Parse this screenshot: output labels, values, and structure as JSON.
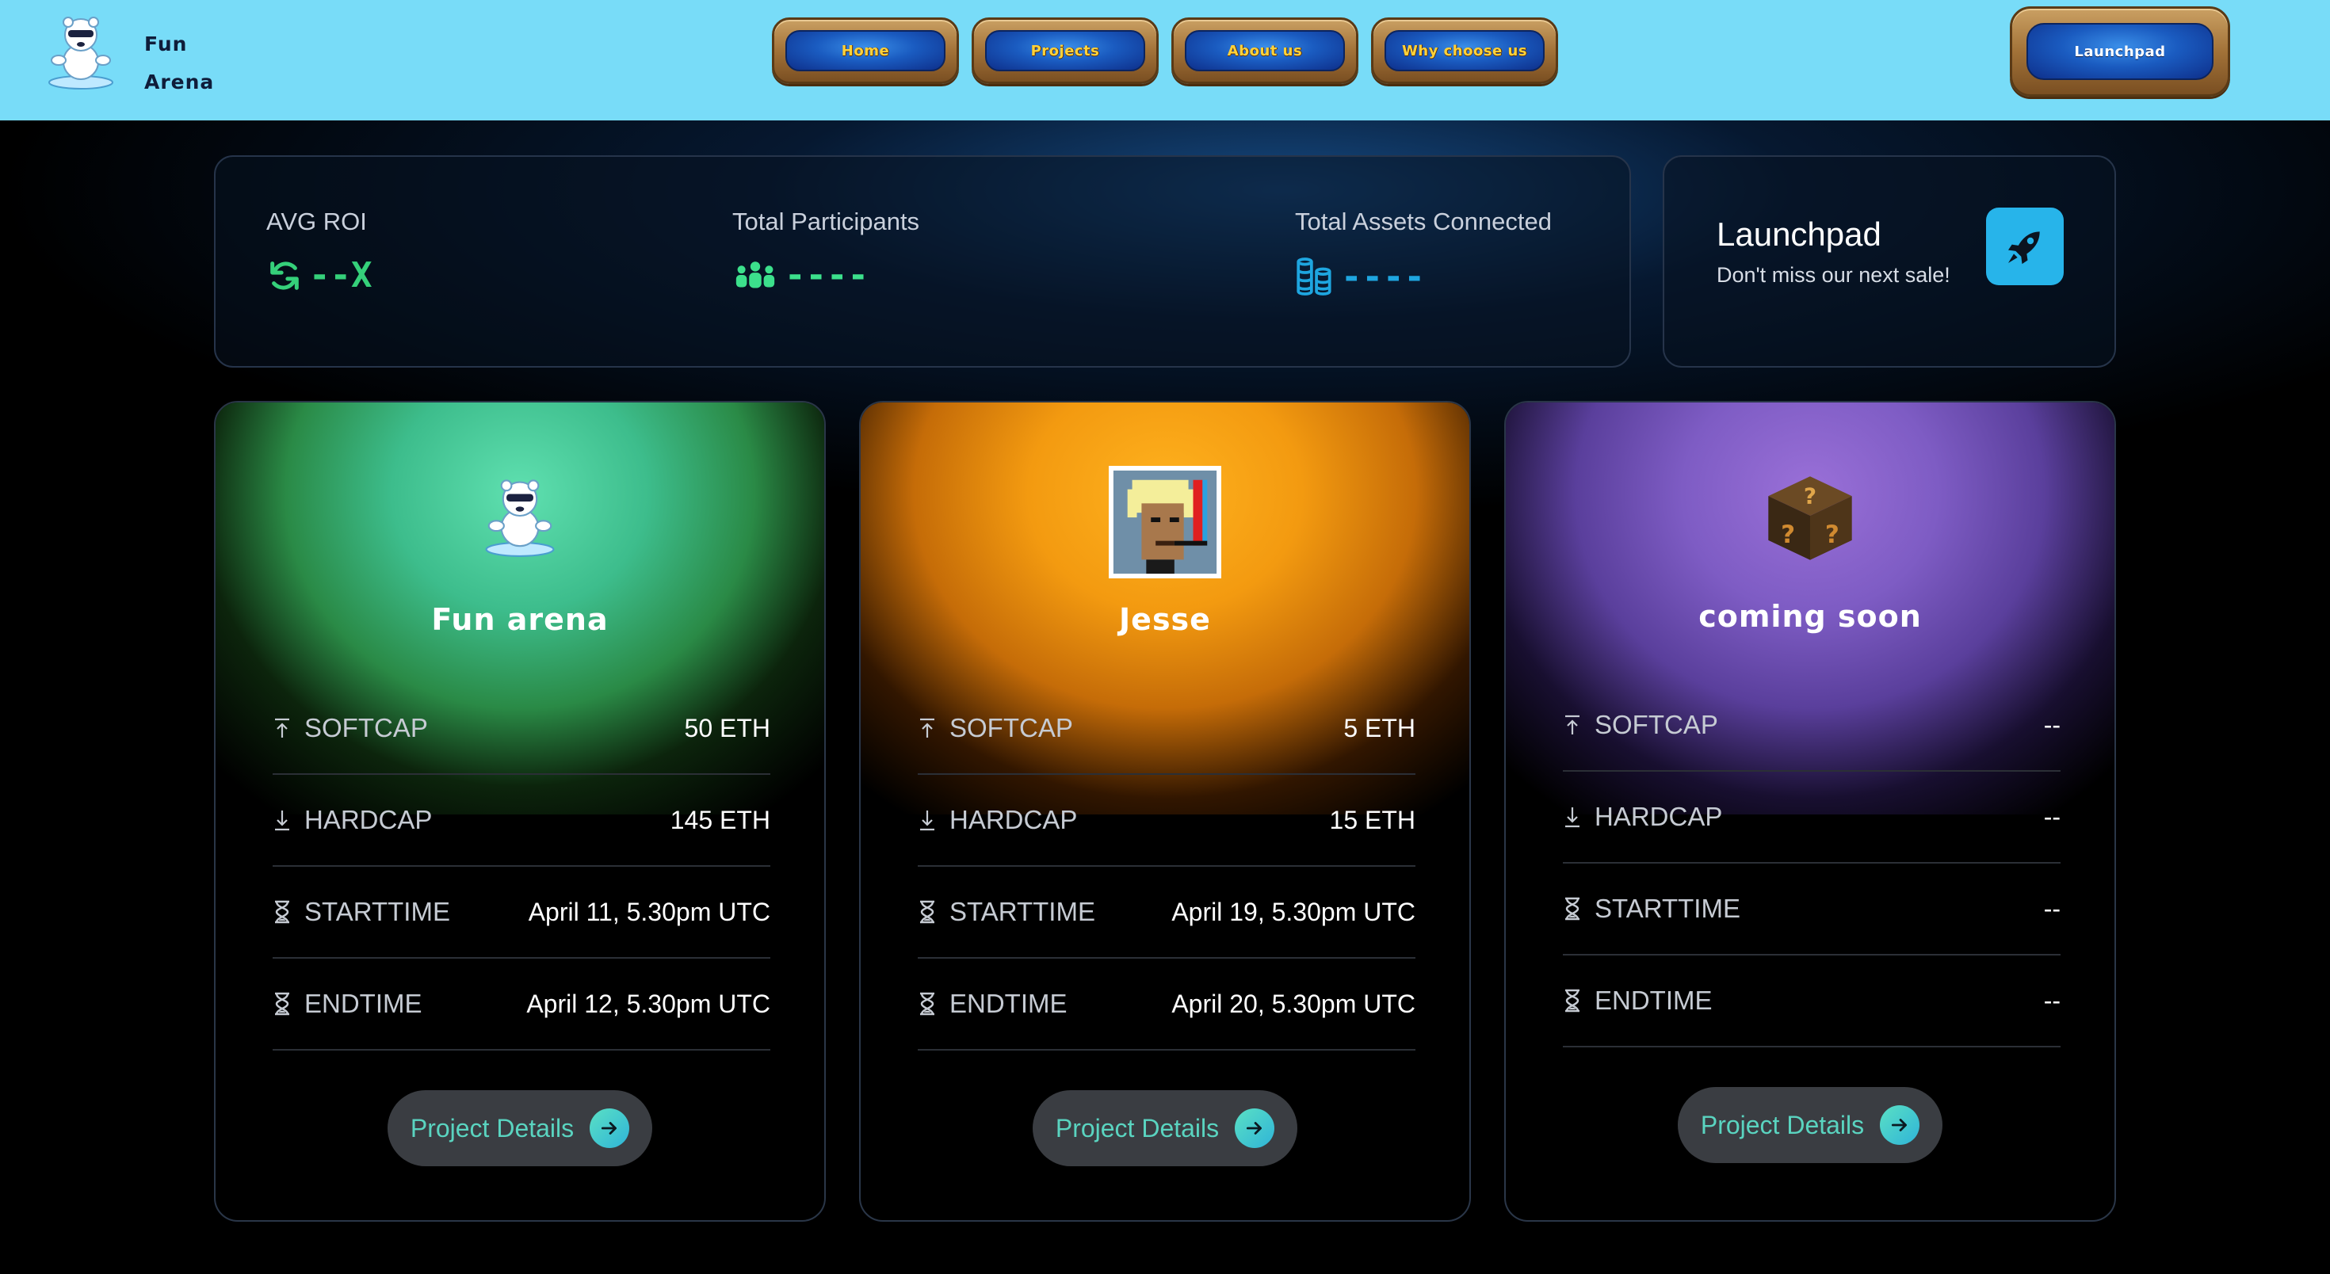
{
  "header": {
    "logo_text_line1": "Fun",
    "logo_text_line2": "Arena",
    "nav": [
      {
        "label": "Home"
      },
      {
        "label": "Projects"
      },
      {
        "label": "About us"
      },
      {
        "label": "Why choose us"
      }
    ],
    "launchpad_button": "Launchpad"
  },
  "stats": {
    "avg_roi": {
      "label": "AVG ROI",
      "value": "--X",
      "icon": "refresh-icon",
      "color": "#35d07a"
    },
    "participants": {
      "label": "Total Participants",
      "value": "----",
      "icon": "users-icon",
      "color": "#3ce08c"
    },
    "assets": {
      "label": "Total Assets Connected",
      "value": "----",
      "icon": "coins-icon",
      "color": "#1ea6e0"
    }
  },
  "launchpad_card": {
    "title": "Launchpad",
    "subtitle": "Don't miss our next sale!",
    "icon": "rocket-icon"
  },
  "projects": [
    {
      "name": "Fun arena",
      "theme": "green",
      "rows": [
        {
          "label": "SOFTCAP",
          "value": "50 ETH",
          "icon": "arrow-up-bar-icon"
        },
        {
          "label": "HARDCAP",
          "value": "145 ETH",
          "icon": "download-icon"
        },
        {
          "label": "STARTTIME",
          "value": "April 11, 5.30pm UTC",
          "icon": "hourglass-icon"
        },
        {
          "label": "ENDTIME",
          "value": "April 12, 5.30pm UTC",
          "icon": "hourglass-icon"
        }
      ],
      "button": "Project Details"
    },
    {
      "name": "Jesse",
      "theme": "orange",
      "rows": [
        {
          "label": "SOFTCAP",
          "value": "5 ETH",
          "icon": "arrow-up-bar-icon"
        },
        {
          "label": "HARDCAP",
          "value": "15 ETH",
          "icon": "download-icon"
        },
        {
          "label": "STARTTIME",
          "value": "April 19, 5.30pm UTC",
          "icon": "hourglass-icon"
        },
        {
          "label": "ENDTIME",
          "value": "April 20, 5.30pm UTC",
          "icon": "hourglass-icon"
        }
      ],
      "button": "Project Details"
    },
    {
      "name": "coming soon",
      "theme": "purple",
      "rows": [
        {
          "label": "SOFTCAP",
          "value": "--",
          "icon": "arrow-up-bar-icon"
        },
        {
          "label": "HARDCAP",
          "value": "--",
          "icon": "download-icon"
        },
        {
          "label": "STARTTIME",
          "value": "--",
          "icon": "hourglass-icon"
        },
        {
          "label": "ENDTIME",
          "value": "--",
          "icon": "hourglass-icon"
        }
      ],
      "button": "Project Details"
    }
  ]
}
